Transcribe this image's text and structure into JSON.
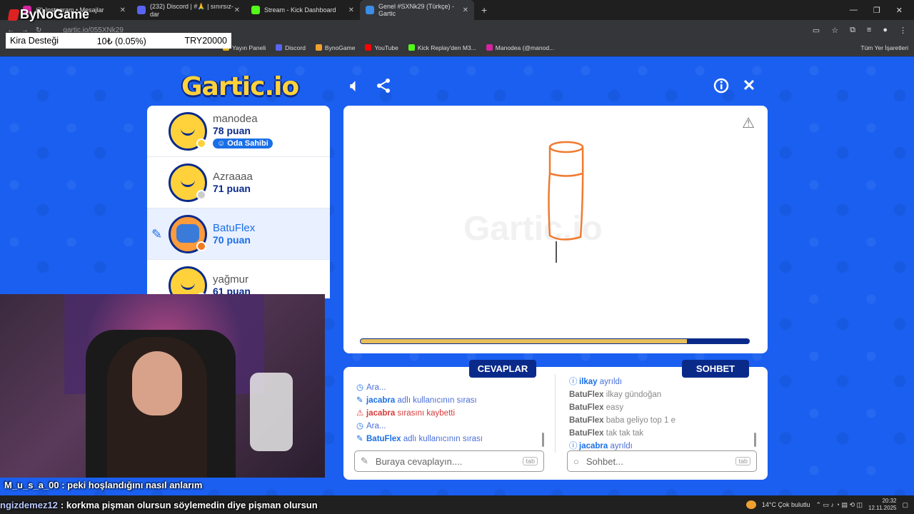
{
  "browser": {
    "tabs": [
      {
        "title": "(2) Instagram • Mesajlar",
        "color": "#d6249f",
        "active": false
      },
      {
        "title": "(232) Discord | #🙏 | sınırsız-dar",
        "color": "#5865f2",
        "active": false
      },
      {
        "title": "Stream - Kick Dashboard",
        "color": "#53fc18",
        "active": false
      },
      {
        "title": "Genel #SXNk29 (Türkçe) - Gartic",
        "color": "#3a8ee6",
        "active": true
      }
    ],
    "new_tab": "+",
    "url": "gartic.io/055XNk29",
    "bookmarks": [
      {
        "label": "Yayın Paneli",
        "color": "#e0b020"
      },
      {
        "label": "Discord",
        "color": "#5865f2"
      },
      {
        "label": "BynoGame",
        "color": "#f0a030"
      },
      {
        "label": "YouTube",
        "color": "#ff0000"
      },
      {
        "label": "Kick Replay'den M3...",
        "color": "#53fc18"
      },
      {
        "label": "Manodea (@manod...",
        "color": "#d6249f"
      }
    ],
    "all_bookmarks": "Tüm Yer İşaretleri"
  },
  "overlay": {
    "brand": "ByNoGame",
    "kira_label": "Kira Desteği",
    "kira_amount": "10₺ (0.05%)",
    "kira_target": "TRY20000"
  },
  "game": {
    "logo": "Gartic.io",
    "players": [
      {
        "name": "manodea",
        "points": "78 puan",
        "status_color": "#ffd23c",
        "owner_badge": "Oda Sahibi"
      },
      {
        "name": "Azraaaa",
        "points": "71 puan",
        "status_color": "#cccccc"
      },
      {
        "name": "BatuFlex",
        "points": "70 puan",
        "status_color": "#f07a20",
        "drawing": true
      },
      {
        "name": "yağmur",
        "points": "61 puan",
        "status_color": "#cccccc"
      }
    ],
    "watermark": "Gartic.io",
    "timer_progress": 0.84,
    "answers_label": "CEVAPLAR",
    "chat_label": "SOHBET",
    "answers": [
      {
        "type": "info",
        "text": "Ara..."
      },
      {
        "type": "turn",
        "user": "jacabra",
        "text": " adlı kullanıcının sırası"
      },
      {
        "type": "lost",
        "user": "jacabra",
        "text": " sırasını kaybetti"
      },
      {
        "type": "info",
        "text": "Ara..."
      },
      {
        "type": "turn",
        "user": "BatuFlex",
        "text": " adlı kullanıcının sırası"
      }
    ],
    "chat": [
      {
        "type": "info",
        "user": "ilkay",
        "text": " ayrıldı"
      },
      {
        "type": "msg",
        "user": "BatuFlex",
        "text": " ilkay gündoğan"
      },
      {
        "type": "msg",
        "user": "BatuFlex",
        "text": " easy"
      },
      {
        "type": "msg",
        "user": "BatuFlex",
        "text": " baba geliyo top 1 e"
      },
      {
        "type": "msg",
        "user": "BatuFlex",
        "text": " tak tak tak"
      },
      {
        "type": "info",
        "user": "jacabra",
        "text": " ayrıldı"
      }
    ],
    "answer_placeholder": "Buraya cevaplayın....",
    "chat_placeholder": "Sohbet...",
    "tab_key": "tab"
  },
  "stream_chat": {
    "line1": "M_u_s_a_00 : peki hoşlandığını nasıl anlarım",
    "line2_user": "ngizdemez12",
    "line2_text": ": korkma pişman olursun söylemedin diye pişman olursun"
  },
  "taskbar": {
    "weather": "14°C  Çok bulutlu",
    "time": "20:32",
    "date": "12.11.2025"
  }
}
